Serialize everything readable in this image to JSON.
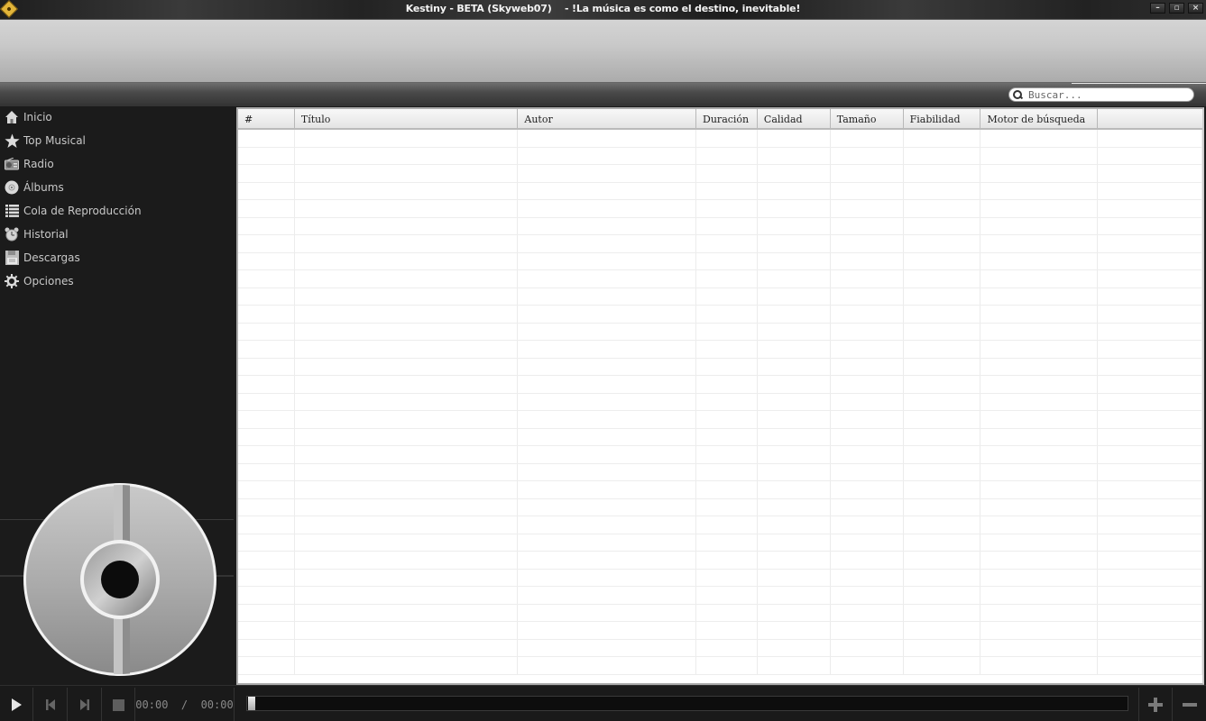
{
  "window": {
    "title": "Kestiny - BETA (Skyweb07)    - !La música es como el destino, inevitable!",
    "controls": {
      "minimize": "–",
      "maximize": "▫",
      "close": "×"
    }
  },
  "search": {
    "placeholder": "Buscar...",
    "value": ""
  },
  "sidebar": {
    "items": [
      {
        "label": "Inicio",
        "icon": "home-icon"
      },
      {
        "label": "Top Musical",
        "icon": "star-icon"
      },
      {
        "label": "Radio",
        "icon": "radio-icon"
      },
      {
        "label": "Álbums",
        "icon": "disc-icon"
      },
      {
        "label": "Cola de Reproducción",
        "icon": "list-icon"
      },
      {
        "label": "Historial",
        "icon": "alarm-clock-icon"
      },
      {
        "label": "Descargas",
        "icon": "floppy-disk-icon"
      },
      {
        "label": "Opciones",
        "icon": "gear-icon"
      }
    ]
  },
  "table": {
    "columns": [
      "#",
      "Título",
      "Autor",
      "Duración",
      "Calidad",
      "Tamaño",
      "Fiabilidad",
      "Motor de búsqueda",
      ""
    ],
    "rows": []
  },
  "player": {
    "current_time": "00:00",
    "separator": "/",
    "total_time": "00:00",
    "progress": 0,
    "volume_up": "+",
    "volume_down": "−"
  }
}
